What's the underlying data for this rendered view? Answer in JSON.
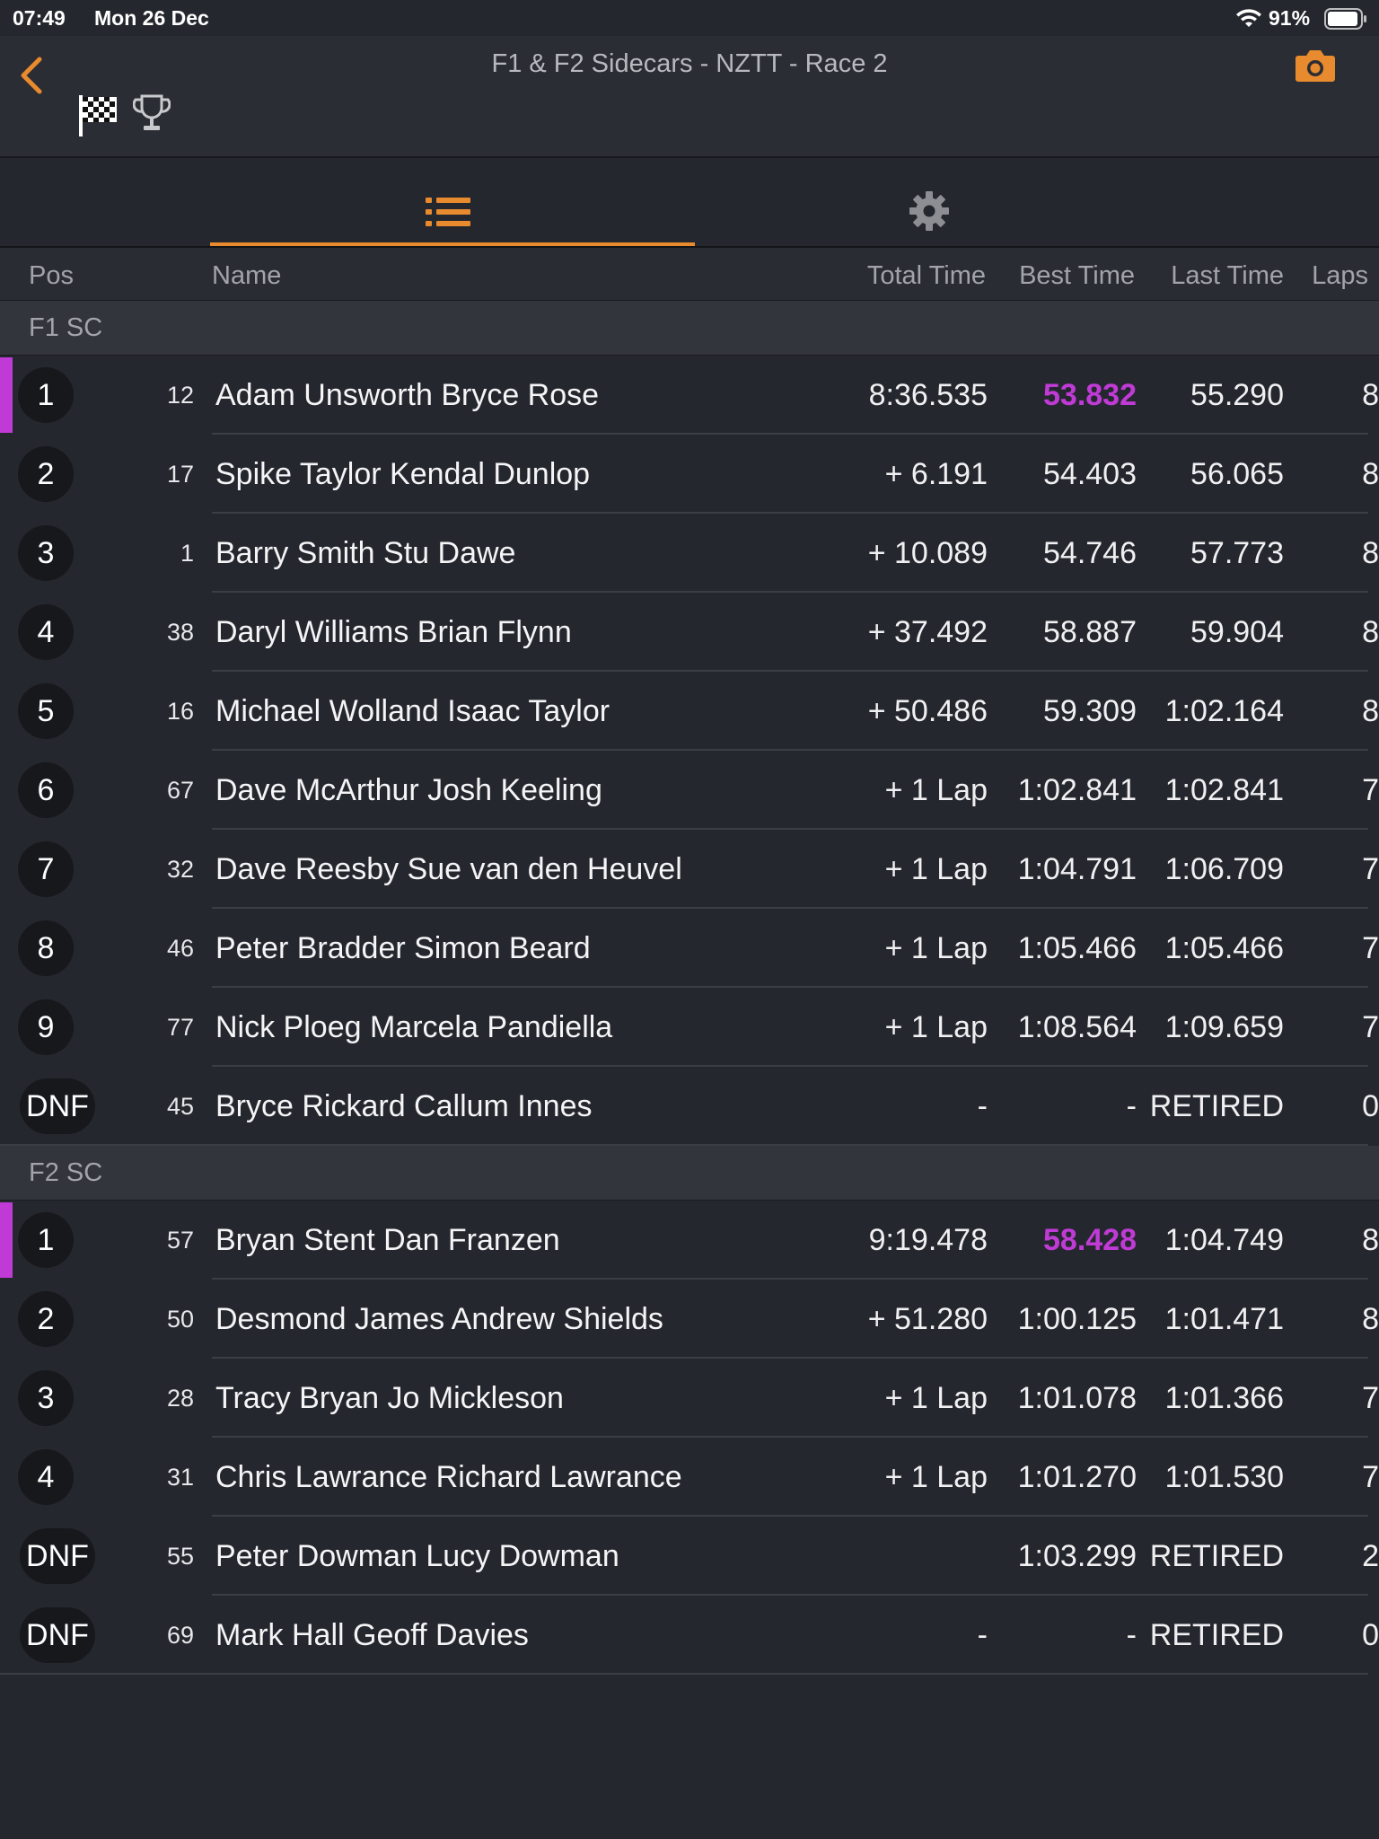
{
  "status": {
    "time": "07:49",
    "date": "Mon 26 Dec",
    "battery": "91%"
  },
  "nav": {
    "title": "F1 & F2 Sidecars - NZTT - Race 2"
  },
  "icons": {
    "back": "chevron-left-icon",
    "camera": "camera-icon",
    "flag": "checkered-flag-icon",
    "trophy": "trophy-icon",
    "list": "list-icon",
    "settings": "gear-icon"
  },
  "colors": {
    "accent": "#e88a2e",
    "fastest": "#c03bd6",
    "background": "#25272e"
  },
  "columns": {
    "pos": "Pos",
    "name": "Name",
    "total": "Total Time",
    "best": "Best Time",
    "last": "Last Time",
    "laps": "Laps"
  },
  "groups": [
    {
      "name": "F1 SC",
      "rows": [
        {
          "pos": "1",
          "num": "12",
          "name": "Adam Unsworth Bryce Rose",
          "total": "8:36.535",
          "best": "53.832",
          "last": "55.290",
          "laps": "8",
          "fastest": true
        },
        {
          "pos": "2",
          "num": "17",
          "name": "Spike Taylor Kendal Dunlop",
          "total": "+ 6.191",
          "best": "54.403",
          "last": "56.065",
          "laps": "8"
        },
        {
          "pos": "3",
          "num": "1",
          "name": "Barry Smith Stu Dawe",
          "total": "+ 10.089",
          "best": "54.746",
          "last": "57.773",
          "laps": "8"
        },
        {
          "pos": "4",
          "num": "38",
          "name": "Daryl Williams Brian Flynn",
          "total": "+ 37.492",
          "best": "58.887",
          "last": "59.904",
          "laps": "8"
        },
        {
          "pos": "5",
          "num": "16",
          "name": "Michael Wolland Isaac Taylor",
          "total": "+ 50.486",
          "best": "59.309",
          "last": "1:02.164",
          "laps": "8"
        },
        {
          "pos": "6",
          "num": "67",
          "name": "Dave McArthur Josh Keeling",
          "total": "+ 1 Lap",
          "best": "1:02.841",
          "last": "1:02.841",
          "laps": "7"
        },
        {
          "pos": "7",
          "num": "32",
          "name": "Dave Reesby Sue van den Heuvel",
          "total": "+ 1 Lap",
          "best": "1:04.791",
          "last": "1:06.709",
          "laps": "7"
        },
        {
          "pos": "8",
          "num": "46",
          "name": "Peter Bradder Simon Beard",
          "total": "+ 1 Lap",
          "best": "1:05.466",
          "last": "1:05.466",
          "laps": "7"
        },
        {
          "pos": "9",
          "num": "77",
          "name": "Nick Ploeg Marcela Pandiella",
          "total": "+ 1 Lap",
          "best": "1:08.564",
          "last": "1:09.659",
          "laps": "7"
        },
        {
          "pos": "DNF",
          "num": "45",
          "name": "Bryce Rickard Callum Innes",
          "total": "-",
          "best": "-",
          "last": "RETIRED",
          "laps": "0"
        }
      ]
    },
    {
      "name": "F2 SC",
      "rows": [
        {
          "pos": "1",
          "num": "57",
          "name": "Bryan Stent Dan Franzen",
          "total": "9:19.478",
          "best": "58.428",
          "last": "1:04.749",
          "laps": "8",
          "fastest": true
        },
        {
          "pos": "2",
          "num": "50",
          "name": "Desmond James Andrew Shields",
          "total": "+ 51.280",
          "best": "1:00.125",
          "last": "1:01.471",
          "laps": "8"
        },
        {
          "pos": "3",
          "num": "28",
          "name": "Tracy Bryan Jo Mickleson",
          "total": "+ 1 Lap",
          "best": "1:01.078",
          "last": "1:01.366",
          "laps": "7"
        },
        {
          "pos": "4",
          "num": "31",
          "name": "Chris Lawrance Richard Lawrance",
          "total": "+ 1 Lap",
          "best": "1:01.270",
          "last": "1:01.530",
          "laps": "7"
        },
        {
          "pos": "DNF",
          "num": "55",
          "name": "Peter Dowman Lucy Dowman",
          "total": "",
          "best": "1:03.299",
          "last": "RETIRED",
          "laps": "2"
        },
        {
          "pos": "DNF",
          "num": "69",
          "name": "Mark Hall Geoff Davies",
          "total": "-",
          "best": "-",
          "last": "RETIRED",
          "laps": "0"
        }
      ]
    }
  ]
}
